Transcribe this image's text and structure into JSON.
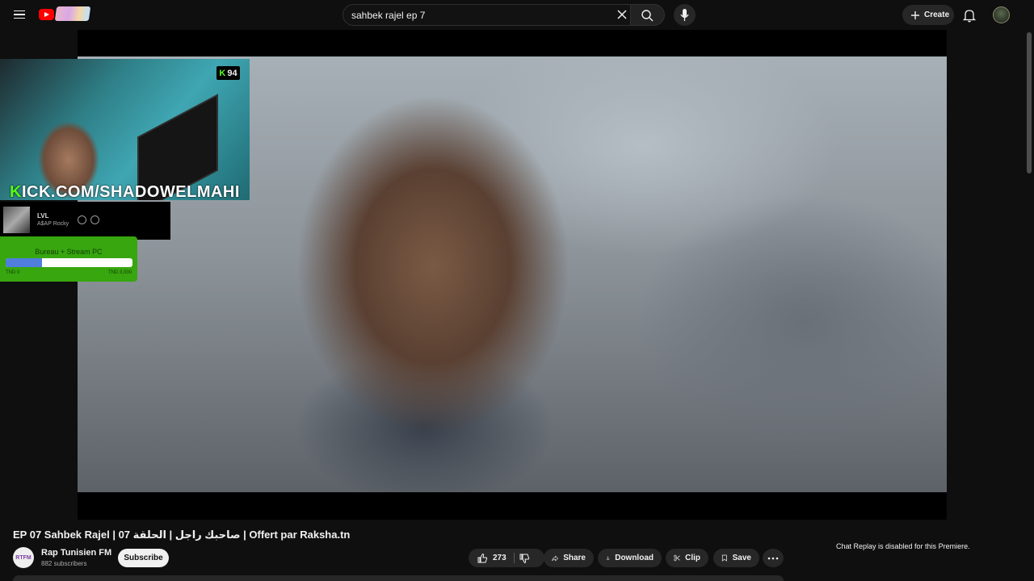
{
  "search": {
    "value": "sahbek rajel ep 7"
  },
  "header": {
    "create_label": "Create"
  },
  "overlay": {
    "kick_badge_count": "94",
    "kick_url_k": "K",
    "kick_url_rest": "ICK.COM/SHADOWELMAHI",
    "song_title": "LVL",
    "song_artist": "A$AP Rocky",
    "goal_title": "Bureau + Stream PC",
    "goal_value": "862",
    "goal_min": "TND 0",
    "goal_max": "TND 3,000",
    "goal_progress_fraction": 0.287
  },
  "video": {
    "title": "EP 07 Sahbek Rajel | صاحبك راجل | الحلقة 07 | Offert par Raksha.tn",
    "channel_name": "Rap Tunisien FM",
    "channel_logo_text": "RTFM",
    "subscribers": "882 subscribers",
    "subscribe_label": "Subscribe",
    "likes": "273",
    "share_label": "Share",
    "download_label": "Download",
    "clip_label": "Clip",
    "save_label": "Save"
  },
  "chat": {
    "note": "Chat Replay is disabled for this Premiere."
  },
  "colors": {
    "kick_green": "#53fc18",
    "goal_green": "#37a60f",
    "goal_fill": "#4f7edc",
    "yt_red": "#ff0000"
  }
}
